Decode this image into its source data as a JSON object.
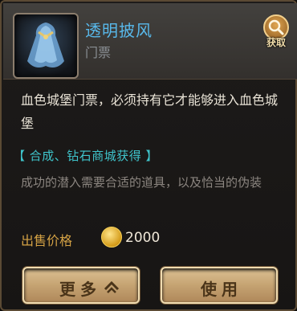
{
  "item": {
    "name": "透明披风",
    "type": "门票",
    "icon": "cloak-icon"
  },
  "fetch_button": {
    "label": "获取",
    "icon": "magnifier-icon"
  },
  "description": "血色城堡门票，必须持有它才能够进入血色城堡",
  "source": "【 合成、钻石商城获得 】",
  "flavor": "成功的潜入需要合适的道具，以及恰当的伪装",
  "price": {
    "label": "出售价格",
    "value": "2000",
    "icon": "gold-coin-icon"
  },
  "buttons": {
    "more": "更多",
    "use": "使用"
  },
  "colors": {
    "item_name": "#58b8ea",
    "source": "#3fc4cb",
    "price_label": "#d4a245",
    "button_gold": "#c5a372"
  }
}
